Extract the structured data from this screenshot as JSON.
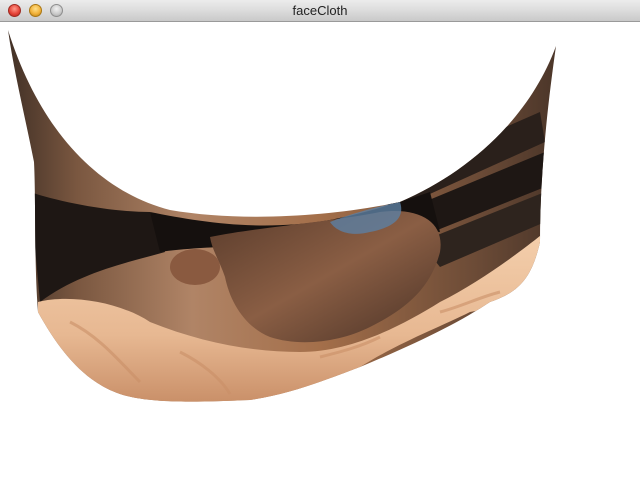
{
  "window": {
    "title": "faceCloth"
  },
  "controls": {
    "close_icon": "close-icon",
    "minimize_icon": "minimize-icon",
    "zoom_icon": "zoom-icon"
  },
  "colors": {
    "background": "#ffffff",
    "skin": "#a46f4a",
    "shirt": "#e7b892",
    "dark": "#1e1714"
  }
}
